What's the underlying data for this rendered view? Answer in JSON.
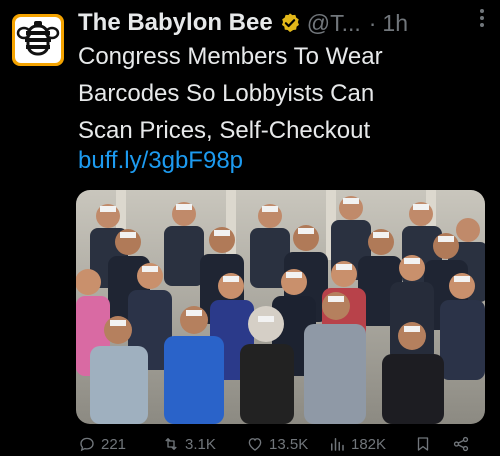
{
  "tweet": {
    "display_name": "The Babylon Bee",
    "handle": "@T...",
    "separator": "·",
    "time": "1h",
    "body_lines": [
      "Congress Members To Wear",
      "Barcodes So Lobbyists Can",
      "Scan Prices, Self-Checkout"
    ],
    "link": "buff.ly/3gbF98p"
  },
  "actions": {
    "replies": "221",
    "retweets": "3.1K",
    "likes": "13.5K",
    "views": "182K"
  },
  "icons": {
    "avatar": "babylon-bee-logo",
    "verified": "verified-gold-badge",
    "more": "more-icon",
    "reply": "reply-icon",
    "retweet": "retweet-icon",
    "like": "heart-icon",
    "views": "views-icon",
    "bookmark": "bookmark-icon",
    "share": "share-icon"
  },
  "colors": {
    "background": "#000000",
    "text": "#e7e9ea",
    "secondary": "#71767b",
    "link": "#1d9bf0",
    "verified_badge": "#e2b719",
    "brand": "#f4a300"
  }
}
